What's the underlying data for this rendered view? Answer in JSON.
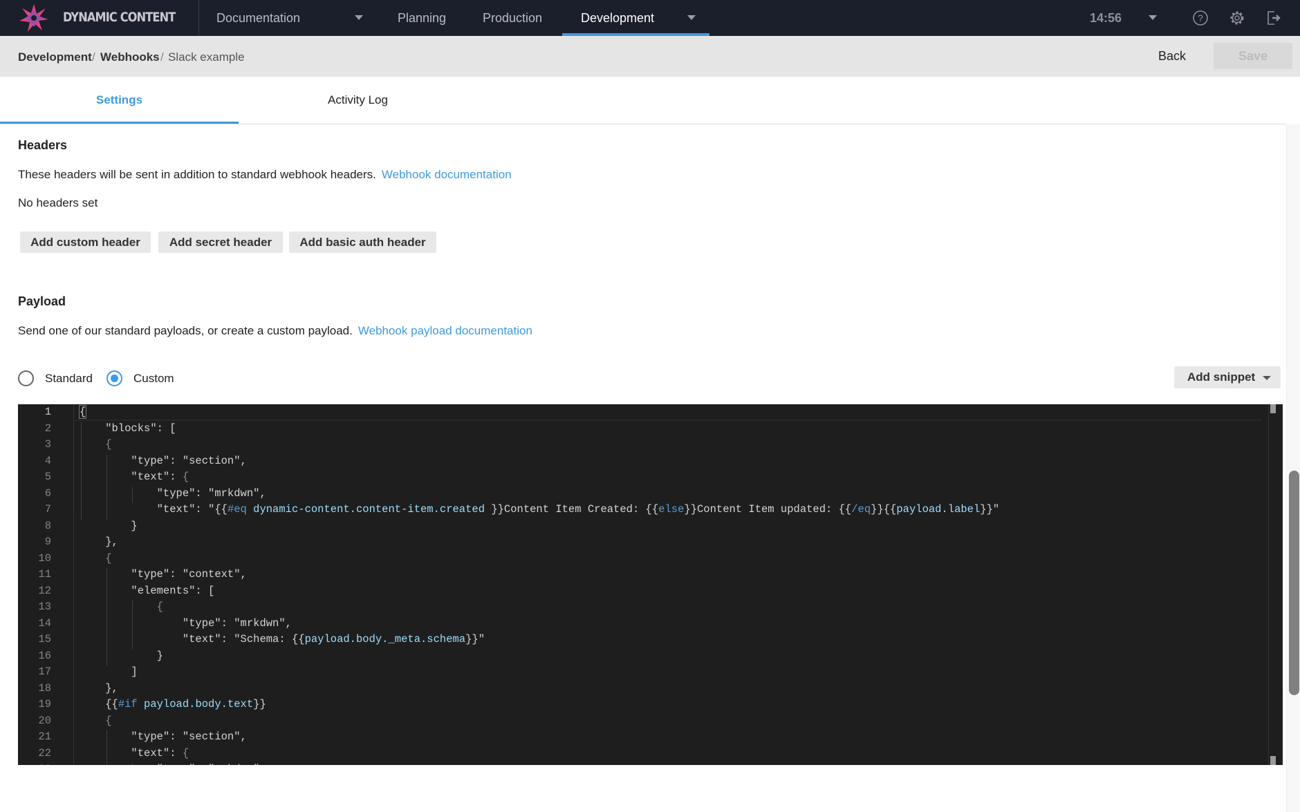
{
  "topnav": {
    "brand": "DYNAMIC CONTENT",
    "items": [
      {
        "label": "Documentation",
        "has_dropdown": true
      },
      {
        "label": "Planning"
      },
      {
        "label": "Production"
      },
      {
        "label": "Development",
        "active": true,
        "has_dropdown": true
      }
    ],
    "time": "14:56",
    "icons": [
      "help-icon",
      "gear-icon",
      "logout-icon"
    ],
    "accent": "#3d9ae0"
  },
  "breadcrumb": {
    "items": [
      "Development",
      "Webhooks",
      "Slack example"
    ],
    "sep": "/"
  },
  "actions": {
    "back": "Back",
    "save": "Save"
  },
  "tabs": [
    {
      "label": "Settings",
      "active": true
    },
    {
      "label": "Activity Log"
    }
  ],
  "headers": {
    "title": "Headers",
    "description": "These headers will be sent in addition to standard webhook headers.",
    "doc_link": "Webhook documentation",
    "empty": "No headers set",
    "buttons": [
      "Add custom header",
      "Add secret header",
      "Add basic auth header"
    ]
  },
  "payload": {
    "title": "Payload",
    "description": "Send one of our standard payloads, or create a custom payload.",
    "doc_link": "Webhook payload documentation",
    "options": [
      {
        "label": "Standard",
        "selected": false
      },
      {
        "label": "Custom",
        "selected": true
      }
    ],
    "add_snippet": "Add snippet"
  },
  "editor": {
    "lines": [
      [
        [
          "{",
          "p"
        ]
      ],
      [
        [
          "    \"blocks\": [",
          "d"
        ]
      ],
      [
        [
          "    {",
          "g"
        ]
      ],
      [
        [
          "        \"type\": \"section\",",
          "d"
        ]
      ],
      [
        [
          "        \"text\": ",
          "d"
        ],
        [
          "{",
          "g"
        ]
      ],
      [
        [
          "            \"type\": \"mrkdwn\",",
          "d"
        ]
      ],
      [
        [
          "            \"text\": \"{{",
          "d"
        ],
        [
          "#eq",
          "k"
        ],
        [
          " ",
          "d"
        ],
        [
          "dynamic-content.content-item.created",
          "v"
        ],
        [
          " }}Content Item Created: {{",
          "d"
        ],
        [
          "else",
          "k"
        ],
        [
          "}}Content Item updated: {{",
          "d"
        ],
        [
          "/eq",
          "k"
        ],
        [
          "}}{{",
          "d"
        ],
        [
          "payload.label",
          "v"
        ],
        [
          "}}\"",
          "d"
        ]
      ],
      [
        [
          "        }",
          "d"
        ]
      ],
      [
        [
          "    },",
          "d"
        ]
      ],
      [
        [
          "    {",
          "g"
        ]
      ],
      [
        [
          "        \"type\": \"context\",",
          "d"
        ]
      ],
      [
        [
          "        \"elements\": [",
          "d"
        ]
      ],
      [
        [
          "            {",
          "g"
        ]
      ],
      [
        [
          "                \"type\": \"mrkdwn\",",
          "d"
        ]
      ],
      [
        [
          "                \"text\": \"Schema: {{",
          "d"
        ],
        [
          "payload.body._meta.schema",
          "v"
        ],
        [
          "}}\"",
          "d"
        ]
      ],
      [
        [
          "            }",
          "d"
        ]
      ],
      [
        [
          "        ]",
          "d"
        ]
      ],
      [
        [
          "    },",
          "d"
        ]
      ],
      [
        [
          "    {{",
          "d"
        ],
        [
          "#if",
          "k"
        ],
        [
          " ",
          "d"
        ],
        [
          "payload.body.text",
          "v"
        ],
        [
          "}}",
          "d"
        ]
      ],
      [
        [
          "    {",
          "g"
        ]
      ],
      [
        [
          "        \"type\": \"section\",",
          "d"
        ]
      ],
      [
        [
          "        \"text\": ",
          "d"
        ],
        [
          "{",
          "g"
        ]
      ],
      [
        [
          "            \"type\": \"mrkdwn\",",
          "d"
        ]
      ]
    ],
    "colors": {
      "d": "#d4d4d4",
      "g": "#8a8a8a",
      "k": "#569cd6",
      "v": "#9cdcfe",
      "p": "#d4d4d4"
    }
  }
}
